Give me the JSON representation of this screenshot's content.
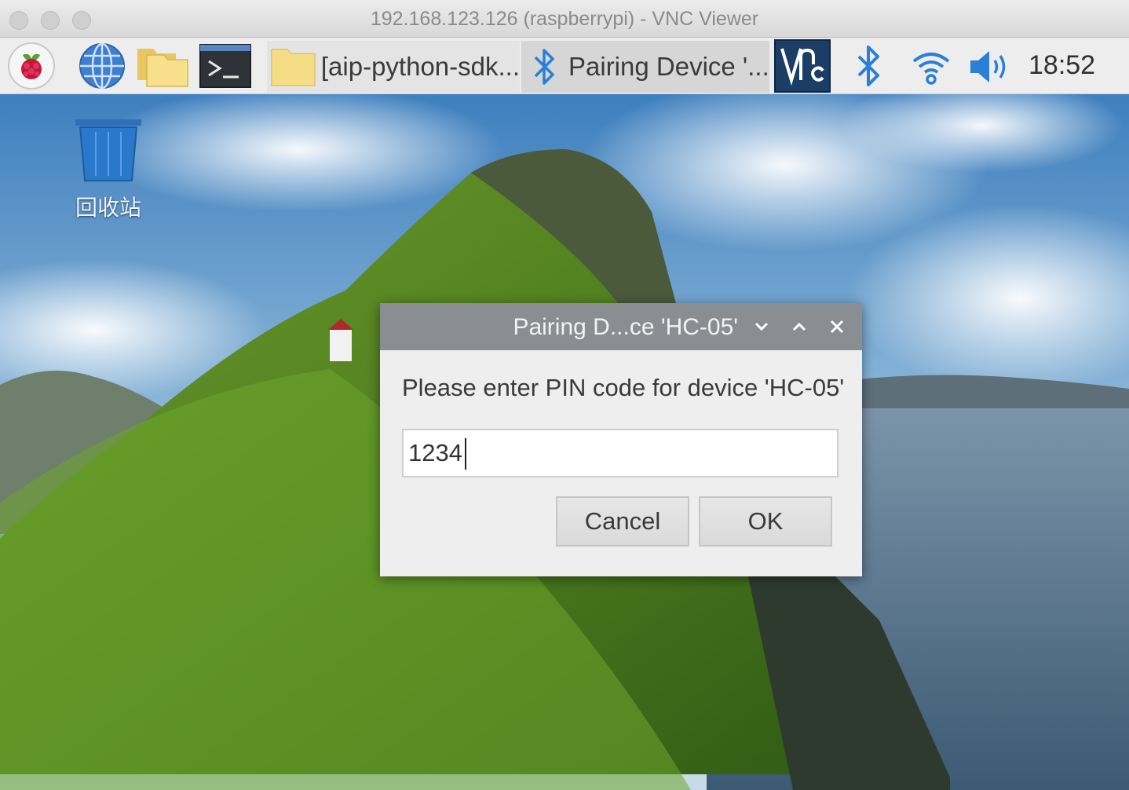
{
  "vnc_window": {
    "title": "192.168.123.126 (raspberrypi) - VNC Viewer"
  },
  "panel": {
    "launchers": [
      "raspberry-menu-icon",
      "web-browser-icon",
      "file-manager-icon",
      "terminal-icon"
    ],
    "taskbar": [
      {
        "label": "[aip-python-sdk...",
        "icon": "folder-icon"
      },
      {
        "label": "Pairing Device '...",
        "icon": "bluetooth-icon"
      }
    ],
    "tray": [
      "vnc-icon",
      "bluetooth-icon",
      "wifi-icon",
      "volume-icon"
    ],
    "clock": "18:52"
  },
  "desktop": {
    "trash_label": "回收站"
  },
  "dialog": {
    "title": "Pairing D...ce 'HC-05'",
    "prompt": "Please enter PIN code for device 'HC-05'",
    "pin_value": "1234",
    "cancel_label": "Cancel",
    "ok_label": "OK"
  },
  "colors": {
    "panel_bg": "#ededed",
    "dialog_title_bg": "#8a8e92",
    "dialog_bg": "#eeeeee",
    "bluetooth_blue": "#2a7fd6"
  }
}
